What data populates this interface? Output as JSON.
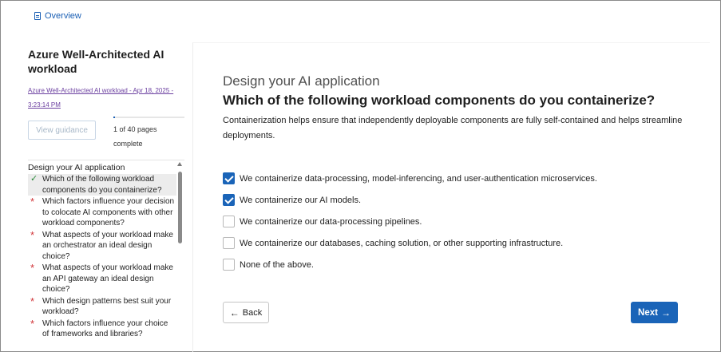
{
  "header": {
    "overview_label": "Overview"
  },
  "sidebar": {
    "assessment_title": "Azure Well-Architected AI workload",
    "assessment_link": "Azure Well-Architected AI workload - Apr 18, 2025 - 3:23:14 PM",
    "guidance_button": "View guidance",
    "progress_text": "1 of 40 pages complete",
    "progress_fraction": 0.025,
    "section_label": "Design your AI application",
    "questions": [
      {
        "text": "Which of the following workload components do you containerize?",
        "status": "answered"
      },
      {
        "text": "Which factors influence your decision to colocate AI components with other workload components?",
        "status": "required"
      },
      {
        "text": "What aspects of your workload make an orchestrator an ideal design choice?",
        "status": "required"
      },
      {
        "text": "What aspects of your workload make an API gateway an ideal design choice?",
        "status": "required"
      },
      {
        "text": "Which design patterns best suit your workload?",
        "status": "required"
      },
      {
        "text": "Which factors influence your choice of frameworks and libraries?",
        "status": "required"
      }
    ]
  },
  "main": {
    "section_title": "Design your AI application",
    "question": "Which of the following workload components do you containerize?",
    "description": "Containerization helps ensure that independently deployable components are fully self-contained and helps streamline deployments.",
    "options": [
      {
        "label": "We containerize data-processing, model-inferencing, and user-authentication microservices.",
        "checked": true
      },
      {
        "label": "We containerize our AI models.",
        "checked": true
      },
      {
        "label": "We containerize our data-processing pipelines.",
        "checked": false
      },
      {
        "label": "We containerize our databases, caching solution, or other supporting infrastructure.",
        "checked": false
      },
      {
        "label": "None of the above.",
        "checked": false
      }
    ],
    "back_label": "Back",
    "next_label": "Next"
  },
  "colors": {
    "accent": "#1a64b8",
    "link": "#1a5fb4",
    "visited_link": "#6b3fa0",
    "check": "#2a8a3a",
    "required": "#d13438"
  },
  "icons": {
    "overview": "document-icon",
    "back": "arrow-left-icon",
    "next": "arrow-right-icon",
    "answered": "checkmark-icon",
    "required": "asterisk-icon"
  }
}
